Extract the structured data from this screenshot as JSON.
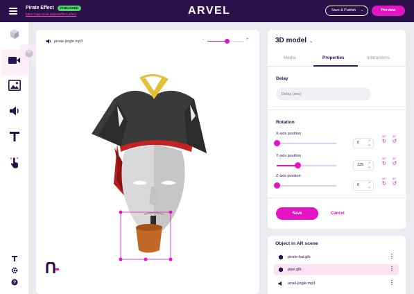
{
  "app": {
    "title": "Pirate Effect",
    "badge": "PUBLISHED",
    "url": "https://app.arvel.io/pirateffect-effect",
    "logo": "ARVEL",
    "save_publish_label": "Save & Publish",
    "preview_label": "Preview"
  },
  "toolbar": {
    "tools": [
      "cube-icon",
      "video-icon",
      "image-icon",
      "audio-icon",
      "text-icon",
      "gesture-icon"
    ],
    "bottom": [
      "typography-icon",
      "settings-icon",
      "help-icon"
    ]
  },
  "canvas": {
    "audio_label": "pirate-jingle.mp3",
    "volume_minus": "-",
    "volume_plus": "+",
    "volume_level": 0.55,
    "logo_glyph": "n-"
  },
  "panel": {
    "title": "3D model",
    "tabs": [
      "Media",
      "Properties",
      "Interactions"
    ],
    "active_tab": "Properties",
    "delay": {
      "label": "Delay",
      "placeholder": "Delay (sec)"
    },
    "rotation": {
      "label": "Rotation",
      "axes": [
        {
          "label": "X axis position",
          "value": "0",
          "level": 0.0
        },
        {
          "label": "Y axis position",
          "value": "125",
          "level": 0.35
        },
        {
          "label": "Z axis position",
          "value": "0",
          "level": 0.0
        }
      ],
      "rotate_ccw_label": "90°",
      "rotate_cw_label": "90°"
    },
    "save_label": "Save",
    "cancel_label": "Cancel"
  },
  "objects": {
    "title": "Object in AR scene",
    "items": [
      {
        "name": "pirate-hat.glb",
        "selected": false
      },
      {
        "name": "pipe.glb",
        "selected": true
      },
      {
        "name": "arvel-jingle.mp3",
        "selected": false
      }
    ]
  },
  "colors": {
    "topbar": "#2a114a",
    "accent": "#e414c4",
    "badge": "#4fd46a",
    "background": "#ecebf1"
  }
}
